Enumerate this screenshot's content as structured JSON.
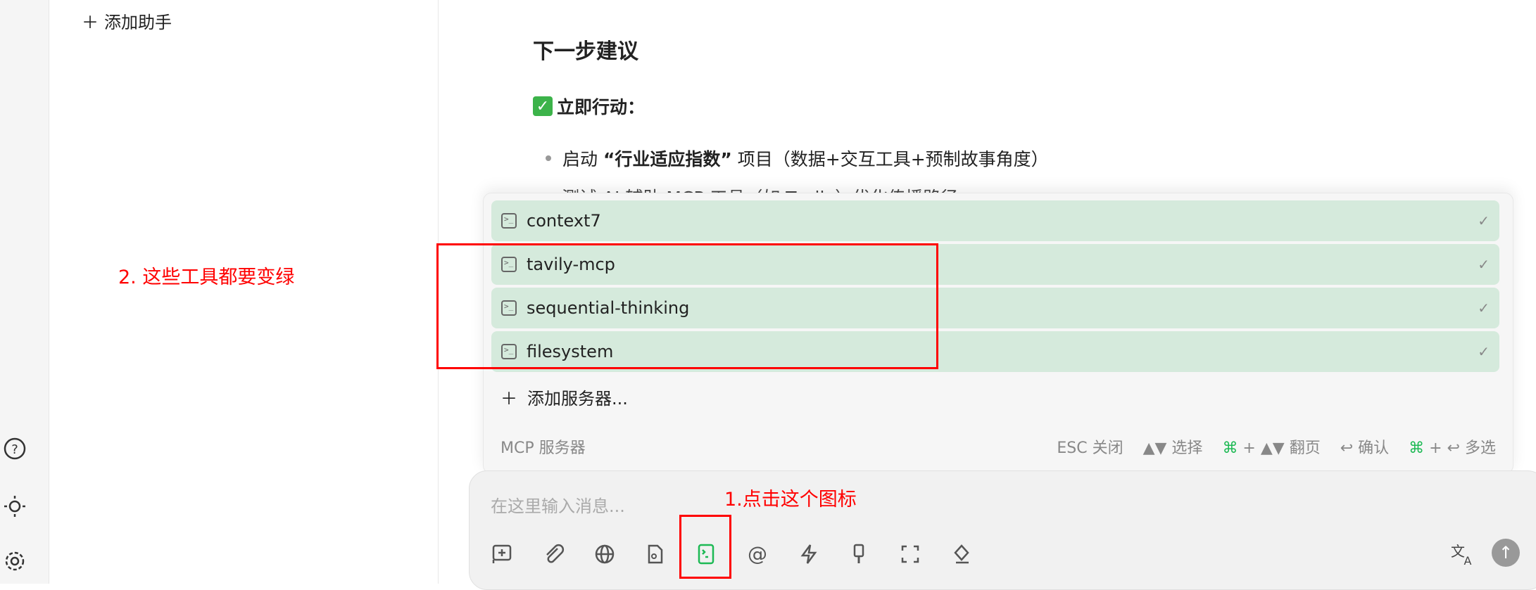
{
  "sidebar": {
    "add_assistant": "添加助手",
    "icons": [
      "help-icon",
      "theme-icon",
      "settings-icon"
    ]
  },
  "message": {
    "heading": "下一步建议",
    "action_label": "立即行动：",
    "bullet_prefix": "启动 ",
    "bullet_bold": "“行业适应指数”",
    "bullet_suffix": " 项目（数据+交互工具+预制故事角度）",
    "partial_line": "测试 AI 辅助 MCP 工具（如 Tavily）优化传播路径"
  },
  "mcp_popup": {
    "servers": [
      {
        "name": "context7",
        "enabled": true
      },
      {
        "name": "tavily-mcp",
        "enabled": true
      },
      {
        "name": "sequential-thinking",
        "enabled": true
      },
      {
        "name": "filesystem",
        "enabled": true
      }
    ],
    "add_server": "添加服务器...",
    "footer_title": "MCP 服务器",
    "shortcuts": {
      "esc": "ESC 关闭",
      "select": "▲▼ 选择",
      "page_key": "⌘",
      "page": " + ▲▼ 翻页",
      "confirm": "↩ 确认",
      "multi_key": "⌘",
      "multi": " + ↩ 多选"
    }
  },
  "input": {
    "placeholder": "在这里输入消息..."
  },
  "annotations": {
    "step1": "1.点击这个图标",
    "step2": "2. 这些工具都要变绿"
  },
  "colors": {
    "accent": "#1db954",
    "enabled_row": "#d5eadc",
    "annotation": "#ff0000"
  }
}
